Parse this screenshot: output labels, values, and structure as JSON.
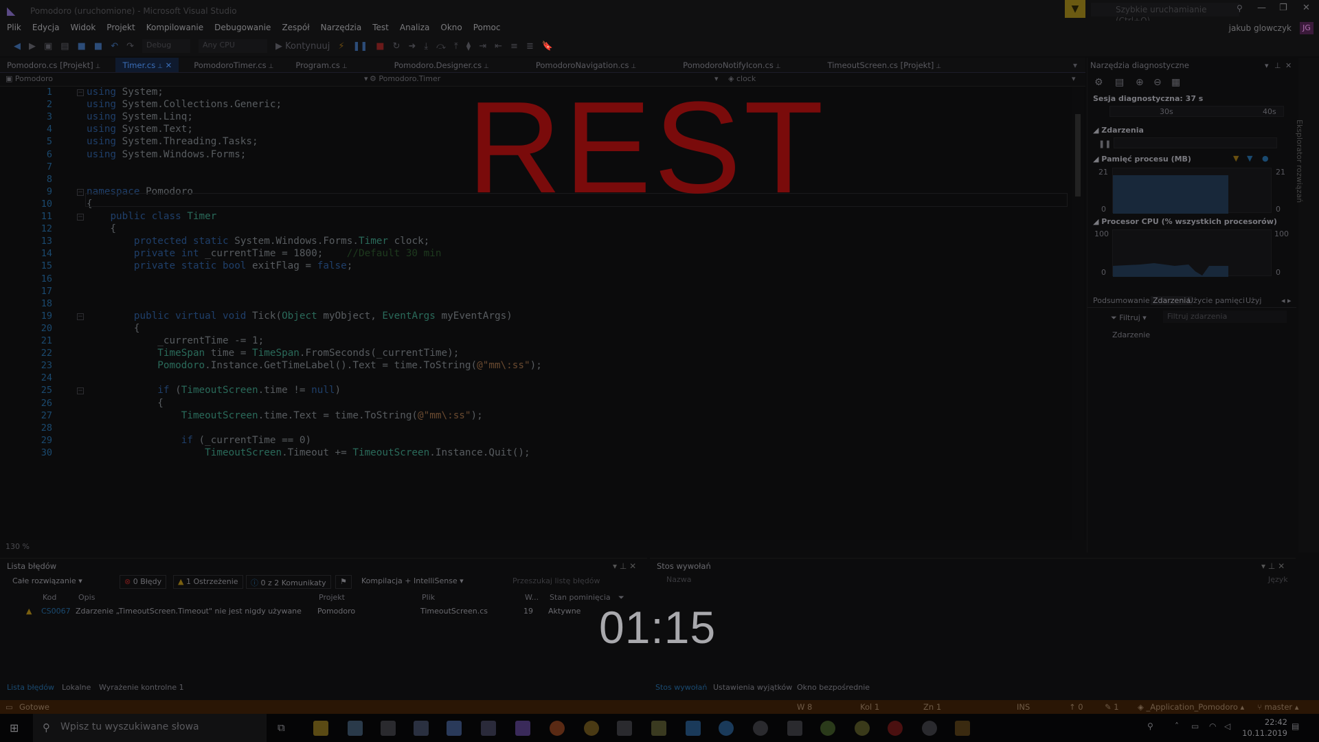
{
  "window": {
    "title": "Pomodoro (uruchomione) - Microsoft Visual Studio",
    "quick_launch": "Szybkie uruchamianie (Ctrl+Q)",
    "user": "jakub glowczyk",
    "avatar": "JG"
  },
  "menu": [
    "Plik",
    "Edycja",
    "Widok",
    "Projekt",
    "Kompilowanie",
    "Debugowanie",
    "Zespół",
    "Narzędzia",
    "Test",
    "Analiza",
    "Okno",
    "Pomoc"
  ],
  "toolbar": {
    "config": "Debug",
    "platform": "Any CPU",
    "continue": "Kontynuuj"
  },
  "tabs": [
    {
      "label": "Pomodoro.cs [Projekt]"
    },
    {
      "label": "Timer.cs"
    },
    {
      "label": "PomodoroTimer.cs"
    },
    {
      "label": "Program.cs"
    },
    {
      "label": "Pomodoro.Designer.cs"
    },
    {
      "label": "PomodoroNavigation.cs"
    },
    {
      "label": "PomodoroNotifyIcon.cs"
    },
    {
      "label": "TimeoutScreen.cs [Projekt]"
    }
  ],
  "navbar": {
    "project": "Pomodoro",
    "type": "Pomodoro.Timer",
    "member": "clock"
  },
  "editor": {
    "zoom": "130 %",
    "overlay": "REST",
    "lines": [
      [
        {
          "t": "k",
          "v": "using"
        },
        {
          "t": "p",
          "v": " System;"
        }
      ],
      [
        {
          "t": "k",
          "v": "using"
        },
        {
          "t": "p",
          "v": " System.Collections.Generic;"
        }
      ],
      [
        {
          "t": "k",
          "v": "using"
        },
        {
          "t": "p",
          "v": " System.Linq;"
        }
      ],
      [
        {
          "t": "k",
          "v": "using"
        },
        {
          "t": "p",
          "v": " System.Text;"
        }
      ],
      [
        {
          "t": "k",
          "v": "using"
        },
        {
          "t": "p",
          "v": " System.Threading.Tasks;"
        }
      ],
      [
        {
          "t": "k",
          "v": "using"
        },
        {
          "t": "p",
          "v": " System.Windows.Forms;"
        }
      ],
      [],
      [],
      [
        {
          "t": "k",
          "v": "namespace"
        },
        {
          "t": "p",
          "v": " Pomodoro"
        }
      ],
      [
        {
          "t": "p",
          "v": "{"
        }
      ],
      [
        {
          "t": "p",
          "v": "    "
        },
        {
          "t": "k",
          "v": "public class"
        },
        {
          "t": "p",
          "v": " "
        },
        {
          "t": "t",
          "v": "Timer"
        }
      ],
      [
        {
          "t": "p",
          "v": "    {"
        }
      ],
      [
        {
          "t": "p",
          "v": "        "
        },
        {
          "t": "k",
          "v": "protected static"
        },
        {
          "t": "p",
          "v": " System.Windows.Forms."
        },
        {
          "t": "t",
          "v": "Timer"
        },
        {
          "t": "p",
          "v": " clock;"
        }
      ],
      [
        {
          "t": "p",
          "v": "        "
        },
        {
          "t": "k",
          "v": "private int"
        },
        {
          "t": "p",
          "v": " _currentTime = 1800;    "
        },
        {
          "t": "c",
          "v": "//Default 30 min"
        }
      ],
      [
        {
          "t": "p",
          "v": "        "
        },
        {
          "t": "k",
          "v": "private static bool"
        },
        {
          "t": "p",
          "v": " exitFlag = "
        },
        {
          "t": "k",
          "v": "false"
        },
        {
          "t": "p",
          "v": ";"
        }
      ],
      [],
      [],
      [],
      [
        {
          "t": "p",
          "v": "        "
        },
        {
          "t": "k",
          "v": "public virtual void"
        },
        {
          "t": "p",
          "v": " Tick("
        },
        {
          "t": "t",
          "v": "Object"
        },
        {
          "t": "p",
          "v": " myObject, "
        },
        {
          "t": "t",
          "v": "EventArgs"
        },
        {
          "t": "p",
          "v": " myEventArgs)"
        }
      ],
      [
        {
          "t": "p",
          "v": "        {"
        }
      ],
      [
        {
          "t": "p",
          "v": "            _currentTime -= 1;"
        }
      ],
      [
        {
          "t": "p",
          "v": "            "
        },
        {
          "t": "t",
          "v": "TimeSpan"
        },
        {
          "t": "p",
          "v": " time = "
        },
        {
          "t": "t",
          "v": "TimeSpan"
        },
        {
          "t": "p",
          "v": ".FromSeconds(_currentTime);"
        }
      ],
      [
        {
          "t": "p",
          "v": "            "
        },
        {
          "t": "t",
          "v": "Pomodoro"
        },
        {
          "t": "p",
          "v": ".Instance.GetTimeLabel().Text = time.ToString("
        },
        {
          "t": "s",
          "v": "@\"mm\\:ss\""
        },
        {
          "t": "p",
          "v": ");"
        }
      ],
      [],
      [
        {
          "t": "p",
          "v": "            "
        },
        {
          "t": "k",
          "v": "if"
        },
        {
          "t": "p",
          "v": " ("
        },
        {
          "t": "t",
          "v": "TimeoutScreen"
        },
        {
          "t": "p",
          "v": ".time != "
        },
        {
          "t": "k",
          "v": "null"
        },
        {
          "t": "p",
          "v": ")"
        }
      ],
      [
        {
          "t": "p",
          "v": "            {"
        }
      ],
      [
        {
          "t": "p",
          "v": "                "
        },
        {
          "t": "t",
          "v": "TimeoutScreen"
        },
        {
          "t": "p",
          "v": ".time.Text = time.ToString("
        },
        {
          "t": "s",
          "v": "@\"mm\\:ss\""
        },
        {
          "t": "p",
          "v": ");"
        }
      ],
      [],
      [
        {
          "t": "p",
          "v": "                "
        },
        {
          "t": "k",
          "v": "if"
        },
        {
          "t": "p",
          "v": " (_currentTime == 0)"
        }
      ],
      [
        {
          "t": "p",
          "v": "                    "
        },
        {
          "t": "t",
          "v": "TimeoutScreen"
        },
        {
          "t": "p",
          "v": ".Timeout += "
        },
        {
          "t": "t",
          "v": "TimeoutScreen"
        },
        {
          "t": "p",
          "v": ".Instance.Quit();"
        }
      ]
    ]
  },
  "diagnostics": {
    "title": "Narzędzia diagnostyczne",
    "session": "Sesja diagnostyczna: 37 s",
    "ticks": [
      "30s",
      "40s"
    ],
    "events_label": "Zdarzenia",
    "memory_label": "Pamięć procesu (MB)",
    "mem_max": "21",
    "mem_min": "0",
    "cpu_label": "Procesor CPU (% wszystkich procesorów)",
    "cpu_max": "100",
    "cpu_min": "0",
    "subtabs": [
      "Podsumowanie",
      "Zdarzenia",
      "Użycie pamięci",
      "Użyj"
    ],
    "filter": "Filtruj",
    "filter_placeholder": "Filtruj zdarzenia",
    "event_col": "Zdarzenie",
    "side_tab": "Eksplorator rozwiązań"
  },
  "errors": {
    "title": "Lista błędów",
    "scope": "Całe rozwiązanie",
    "errors": "0 Błędy",
    "warnings": "1 Ostrzeżenie",
    "messages": "0 z 2 Komunikaty",
    "build": "Kompilacja + IntelliSense",
    "search": "Przeszukaj listę błędów",
    "columns": [
      "Kod",
      "Opis",
      "Projekt",
      "Plik",
      "W...",
      "Stan pominięcia"
    ],
    "row": {
      "code": "CS0067",
      "desc": "Zdarzenie „TimeoutScreen.Timeout\" nie jest nigdy używane",
      "project": "Pomodoro",
      "file": "TimeoutScreen.cs",
      "line": "19",
      "state": "Aktywne"
    },
    "bottom_tabs": [
      "Lista błędów",
      "Lokalne",
      "Wyrażenie kontrolne 1"
    ]
  },
  "callstack": {
    "title": "Stos wywołań",
    "col": "Nazwa",
    "col2": "Język",
    "bottom_tabs": [
      "Stos wywołań",
      "Ustawienia wyjątków",
      "Okno bezpośrednie"
    ]
  },
  "timer": "01:15",
  "status": {
    "ready": "Gotowe",
    "line": "W 8",
    "col": "Kol 1",
    "ch": "Zn 1",
    "ins": "INS",
    "up": "0",
    "edits": "1",
    "project": "_Application_Pomodoro",
    "branch": "master"
  },
  "taskbar": {
    "search": "Wpisz tu wyszukiwane słowa",
    "time": "22:42",
    "date": "10.11.2019"
  }
}
